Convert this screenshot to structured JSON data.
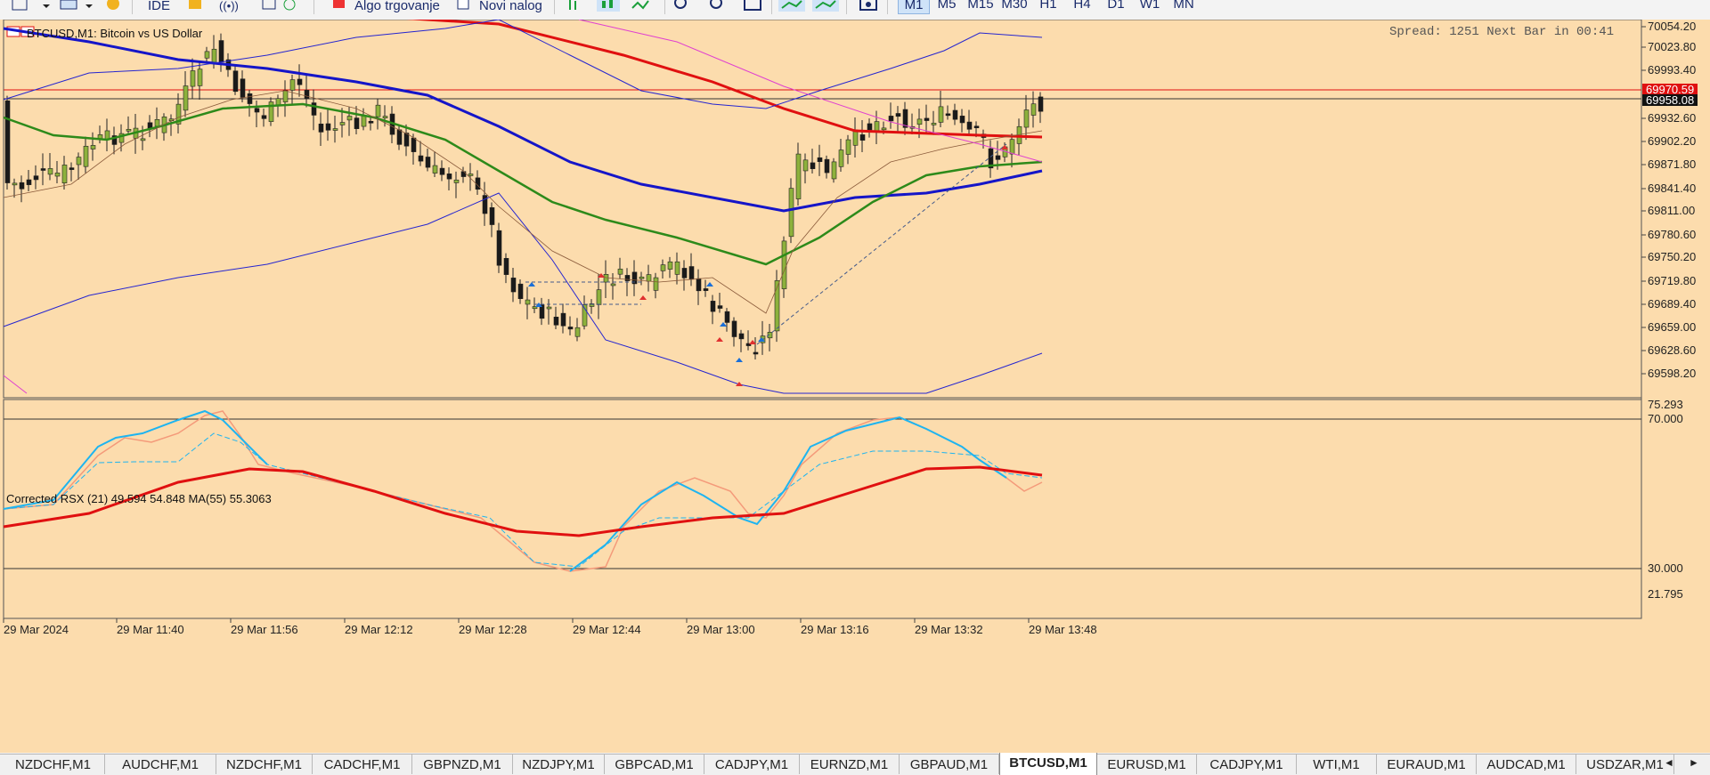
{
  "toolbar": {
    "algo_label": "Algo trgovanje",
    "new_order_label": "Novi nalog",
    "ide_label": "IDE",
    "timeframes": [
      "M1",
      "M5",
      "M15",
      "M30",
      "H1",
      "H4",
      "D1",
      "W1",
      "MN"
    ],
    "active_timeframe": "M1"
  },
  "chart": {
    "symbol": "BTCUSD,M1:",
    "symbol_desc": "Bitcoin vs US Dollar",
    "spread_info": "Spread: 1251 Next Bar in 00:41",
    "price_labels": [
      "70054.20",
      "70023.80",
      "69993.40",
      "69932.60",
      "69902.20",
      "69871.80",
      "69841.40",
      "69811.00",
      "69780.60",
      "69750.20",
      "69719.80",
      "69689.40",
      "69659.00",
      "69628.60",
      "69598.20"
    ],
    "current_price_red": "69970.59",
    "current_price_black": "69958.08",
    "indicator_label": "Corrected RSX (21) 49.594 54.848 MA(55) 55.3063",
    "indicator_levels": [
      "75.293",
      "70.000",
      "30.000",
      "21.795"
    ],
    "time_labels": [
      "29 Mar 2024",
      "29 Mar 11:40",
      "29 Mar 11:56",
      "29 Mar 12:12",
      "29 Mar 12:28",
      "29 Mar 12:44",
      "29 Mar 13:00",
      "29 Mar 13:16",
      "29 Mar 13:32",
      "29 Mar 13:48"
    ],
    "colors": {
      "background": "#fcdcad",
      "bull": "#8db13c",
      "bear": "#1a1a1a",
      "ma_red": "#e01010",
      "ma_blue": "#1515c8",
      "ma_green": "#2d8a1a",
      "rsx_cyan": "#1eb4f0",
      "rsx_orange": "#f49a7a"
    }
  },
  "tabs": {
    "items": [
      "NZDCHF,M1",
      "AUDCHF,M1",
      "NZDCHF,M1",
      "CADCHF,M1",
      "GBPNZD,M1",
      "NZDJPY,M1",
      "GBPCAD,M1",
      "CADJPY,M1",
      "EURNZD,M1",
      "GBPAUD,M1",
      "BTCUSD,M1",
      "EURUSD,M1",
      "CADJPY,M1",
      "WTI,M1",
      "EURAUD,M1",
      "AUDCAD,M1",
      "USDZAR,M1"
    ],
    "active": "BTCUSD,M1"
  }
}
